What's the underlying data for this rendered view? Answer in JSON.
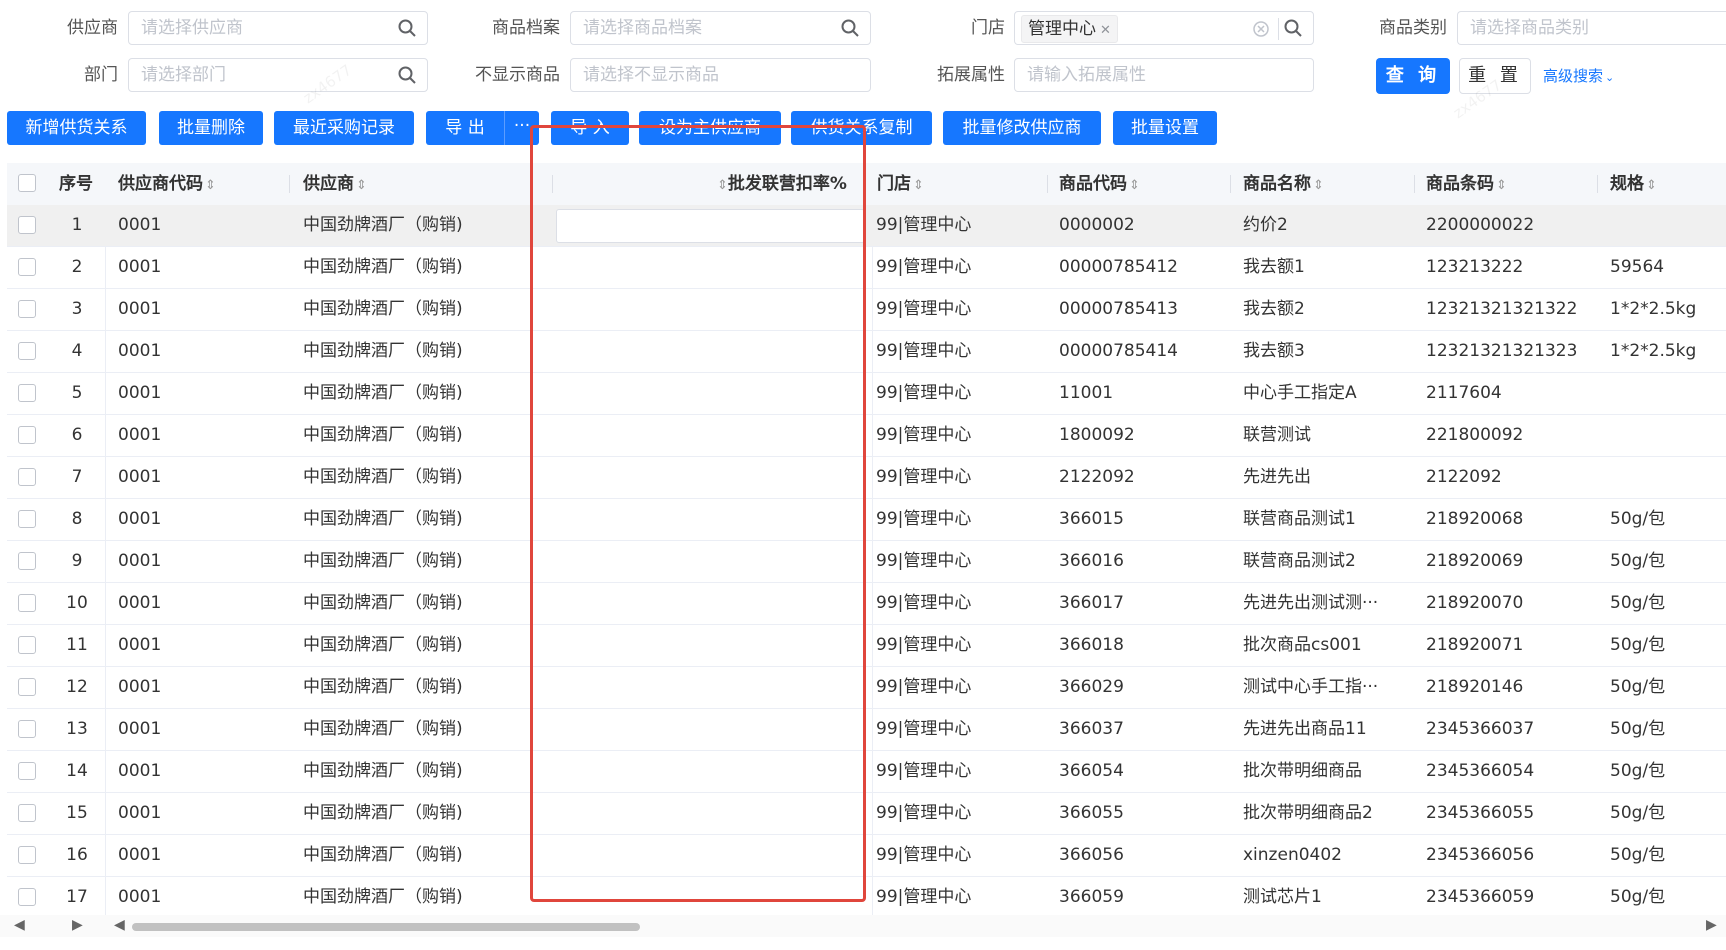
{
  "filters": {
    "supplier": {
      "label": "供应商",
      "placeholder": "请选择供应商"
    },
    "product_archive": {
      "label": "商品档案",
      "placeholder": "请选择商品档案"
    },
    "store": {
      "label": "门店",
      "tag": "管理中心"
    },
    "category": {
      "label": "商品类别",
      "placeholder": "请选择商品类别"
    },
    "department": {
      "label": "部门",
      "placeholder": "请选择部门"
    },
    "hidden_products": {
      "label": "不显示商品",
      "placeholder": "请选择不显示商品"
    },
    "ext_attr": {
      "label": "拓展属性",
      "placeholder": "请输入拓展属性"
    },
    "query_label": "查 询",
    "reset_label": "重 置",
    "advanced_label": "高级搜索"
  },
  "toolbar": {
    "add": "新增供货关系",
    "batch_delete": "批量删除",
    "recent_purchase": "最近采购记录",
    "export": "导 出",
    "more": "···",
    "import": "导 入",
    "set_main": "设为主供应商",
    "copy_relation": "供货关系复制",
    "batch_edit_supplier": "批量修改供应商",
    "batch_settings": "批量设置"
  },
  "table": {
    "headers": {
      "seq": "序号",
      "supplier_code": "供应商代码",
      "supplier": "供应商",
      "wholesale_rate": "批发联营扣率%",
      "store": "门店",
      "product_code": "商品代码",
      "product_name": "商品名称",
      "barcode": "商品条码",
      "spec": "规格"
    },
    "sort_glyph": "⇕",
    "rows": [
      {
        "seq": "1",
        "supplier_code": "0001",
        "supplier": "中国劲牌酒厂（购销)",
        "store": "99|管理中心",
        "product_code": "0000002",
        "product_name": "约价2",
        "barcode": "2200000022",
        "spec": ""
      },
      {
        "seq": "2",
        "supplier_code": "0001",
        "supplier": "中国劲牌酒厂（购销)",
        "store": "99|管理中心",
        "product_code": "00000785412",
        "product_name": "我去额1",
        "barcode": "123213222",
        "spec": "59564"
      },
      {
        "seq": "3",
        "supplier_code": "0001",
        "supplier": "中国劲牌酒厂（购销)",
        "store": "99|管理中心",
        "product_code": "00000785413",
        "product_name": "我去额2",
        "barcode": "12321321321322",
        "spec": "1*2*2.5kg"
      },
      {
        "seq": "4",
        "supplier_code": "0001",
        "supplier": "中国劲牌酒厂（购销)",
        "store": "99|管理中心",
        "product_code": "00000785414",
        "product_name": "我去额3",
        "barcode": "12321321321323",
        "spec": "1*2*2.5kg"
      },
      {
        "seq": "5",
        "supplier_code": "0001",
        "supplier": "中国劲牌酒厂（购销)",
        "store": "99|管理中心",
        "product_code": "11001",
        "product_name": "中心手工指定A",
        "barcode": "2117604",
        "spec": ""
      },
      {
        "seq": "6",
        "supplier_code": "0001",
        "supplier": "中国劲牌酒厂（购销)",
        "store": "99|管理中心",
        "product_code": "1800092",
        "product_name": "联营测试",
        "barcode": "221800092",
        "spec": ""
      },
      {
        "seq": "7",
        "supplier_code": "0001",
        "supplier": "中国劲牌酒厂（购销)",
        "store": "99|管理中心",
        "product_code": "2122092",
        "product_name": "先进先出",
        "barcode": "2122092",
        "spec": ""
      },
      {
        "seq": "8",
        "supplier_code": "0001",
        "supplier": "中国劲牌酒厂（购销)",
        "store": "99|管理中心",
        "product_code": "366015",
        "product_name": "联营商品测试1",
        "barcode": "218920068",
        "spec": "50g/包"
      },
      {
        "seq": "9",
        "supplier_code": "0001",
        "supplier": "中国劲牌酒厂（购销)",
        "store": "99|管理中心",
        "product_code": "366016",
        "product_name": "联营商品测试2",
        "barcode": "218920069",
        "spec": "50g/包"
      },
      {
        "seq": "10",
        "supplier_code": "0001",
        "supplier": "中国劲牌酒厂（购销)",
        "store": "99|管理中心",
        "product_code": "366017",
        "product_name": "先进先出测试测···",
        "barcode": "218920070",
        "spec": "50g/包"
      },
      {
        "seq": "11",
        "supplier_code": "0001",
        "supplier": "中国劲牌酒厂（购销)",
        "store": "99|管理中心",
        "product_code": "366018",
        "product_name": "批次商品cs001",
        "barcode": "218920071",
        "spec": "50g/包"
      },
      {
        "seq": "12",
        "supplier_code": "0001",
        "supplier": "中国劲牌酒厂（购销)",
        "store": "99|管理中心",
        "product_code": "366029",
        "product_name": "测试中心手工指···",
        "barcode": "218920146",
        "spec": "50g/包"
      },
      {
        "seq": "13",
        "supplier_code": "0001",
        "supplier": "中国劲牌酒厂（购销)",
        "store": "99|管理中心",
        "product_code": "366037",
        "product_name": "先进先出商品11",
        "barcode": "2345366037",
        "spec": "50g/包"
      },
      {
        "seq": "14",
        "supplier_code": "0001",
        "supplier": "中国劲牌酒厂（购销)",
        "store": "99|管理中心",
        "product_code": "366054",
        "product_name": "批次带明细商品",
        "barcode": "2345366054",
        "spec": "50g/包"
      },
      {
        "seq": "15",
        "supplier_code": "0001",
        "supplier": "中国劲牌酒厂（购销)",
        "store": "99|管理中心",
        "product_code": "366055",
        "product_name": "批次带明细商品2",
        "barcode": "2345366055",
        "spec": "50g/包"
      },
      {
        "seq": "16",
        "supplier_code": "0001",
        "supplier": "中国劲牌酒厂（购销)",
        "store": "99|管理中心",
        "product_code": "366056",
        "product_name": "xinzen0402",
        "barcode": "2345366056",
        "spec": "50g/包"
      },
      {
        "seq": "17",
        "supplier_code": "0001",
        "supplier": "中国劲牌酒厂（购销)",
        "store": "99|管理中心",
        "product_code": "366059",
        "product_name": "测试芯片1",
        "barcode": "2345366059",
        "spec": "50g/包"
      }
    ]
  },
  "colors": {
    "primary": "#1677ff",
    "highlight": "#e0463c"
  }
}
